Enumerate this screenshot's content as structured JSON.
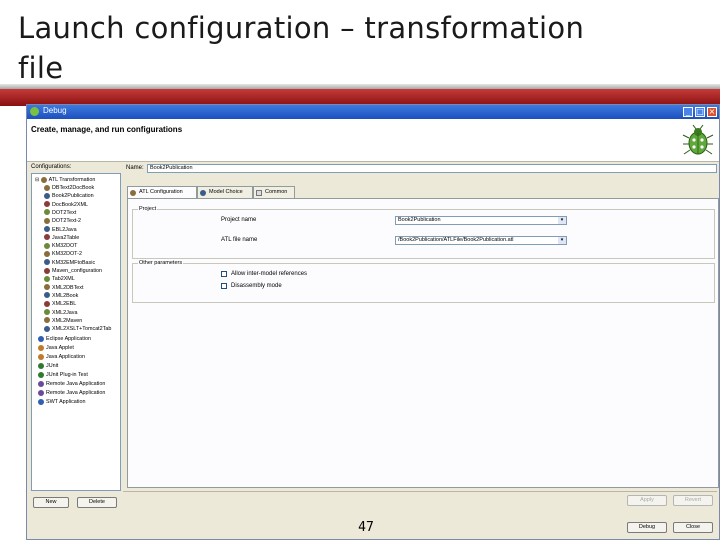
{
  "slide": {
    "title_line1": "Launch configuration – transformation",
    "title_line2": "file",
    "page_number": "47"
  },
  "window": {
    "title": "Debug",
    "heading": "Create, manage, and run configurations",
    "minimize": "_",
    "maximize": "□",
    "close": "×"
  },
  "configurations": {
    "label": "Configurations:",
    "root": "ATL Transformation",
    "items": [
      "DBText2DocBook",
      "Book2Publication",
      "DocBook2XML",
      "DOT2Text",
      "DOT2Text-2",
      "EBL2Java",
      "Java2Table",
      "KM32DOT",
      "KM32DOT-2",
      "KM32EMFtoBasic",
      "Maven_configuration",
      "Tab2XML",
      "XML2DBText",
      "XML2Book",
      "XML2EBL",
      "XML2Java",
      "XML2Maven",
      "XML2XSLT+Tomcat2Tab"
    ],
    "other_groups": [
      "Eclipse Application",
      "Java Applet",
      "Java Application",
      "JUnit",
      "JUnit Plug-in Test",
      "Remote Java Application",
      "Remote Java Application",
      "SWT Application"
    ],
    "new_button": "New",
    "delete_button": "Delete"
  },
  "name_field": {
    "label": "Name:",
    "value": "Book2Publication"
  },
  "tabs": [
    {
      "label": "ATL Configuration",
      "active": true
    },
    {
      "label": "Model Choice",
      "active": false
    },
    {
      "label": "Common",
      "active": false
    }
  ],
  "project_group": {
    "label": "Project",
    "project_name_label": "Project name",
    "project_name_value": "Book2Publication",
    "atl_file_label": "ATL file name",
    "atl_file_value": "/Book2Publication/ATLFile/Book2Publication.atl"
  },
  "other_parameters": {
    "label": "Other parameters",
    "allow_intermodel": "Allow inter-model references",
    "debug_mode": "Disassembly mode"
  },
  "buttons": {
    "apply": "Apply",
    "revert": "Revert",
    "debug": "Debug",
    "close": "Close"
  },
  "colors": {
    "title_band": "#a11c1c",
    "window_title_bar": "#2a5fd0",
    "dialog_bg": "#ece9d8"
  }
}
